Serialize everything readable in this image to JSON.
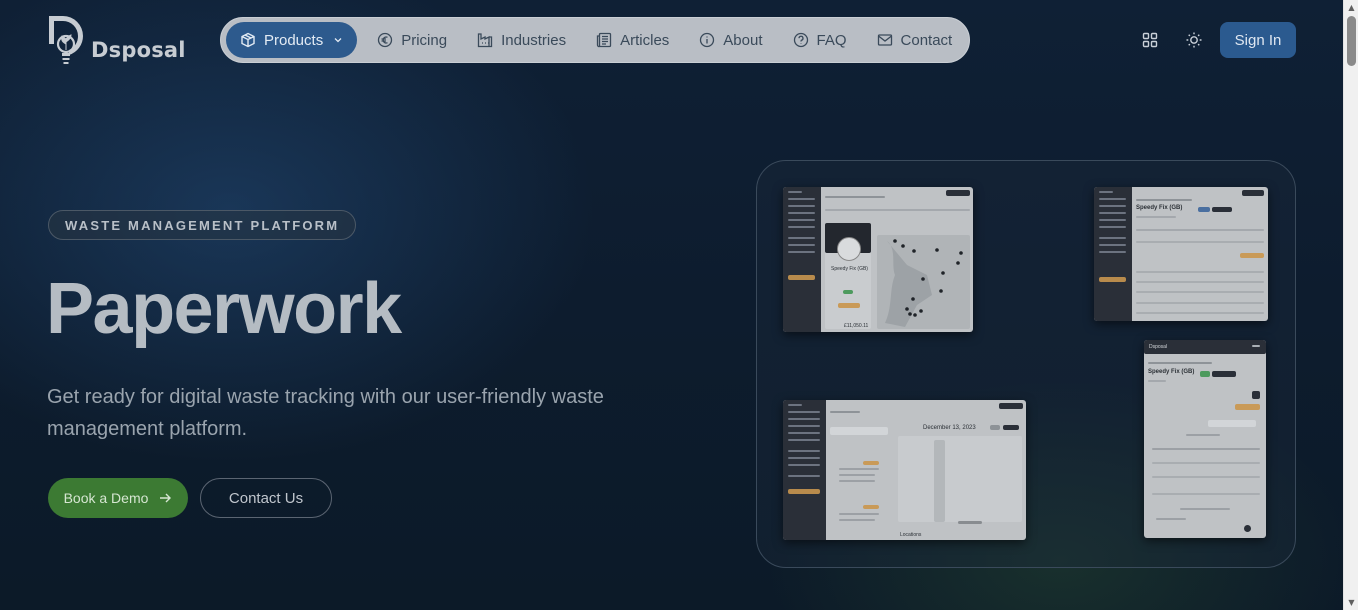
{
  "brand": {
    "name": "Dsposal"
  },
  "nav": {
    "items": [
      {
        "label": "Products",
        "icon": "box-icon",
        "active": true,
        "has_dropdown": true
      },
      {
        "label": "Pricing",
        "icon": "euro-icon"
      },
      {
        "label": "Industries",
        "icon": "factory-icon"
      },
      {
        "label": "Articles",
        "icon": "newspaper-icon"
      },
      {
        "label": "About",
        "icon": "info-icon"
      },
      {
        "label": "FAQ",
        "icon": "help-circle-icon"
      },
      {
        "label": "Contact",
        "icon": "mail-icon"
      }
    ]
  },
  "header": {
    "apps_icon": "grid-icon",
    "theme_icon": "sun-icon",
    "signin_label": "Sign In"
  },
  "hero": {
    "tag": "WASTE MANAGEMENT PLATFORM",
    "headline": "Paperwork",
    "subtitle": "Get ready for digital waste tracking with our user-friendly waste management platform.",
    "primary_cta": "Book a Demo",
    "secondary_cta": "Contact Us"
  },
  "screenshots": {
    "map": {
      "company": "Speedy Fix (GB)",
      "amount": "£11,050.11"
    },
    "detail": {
      "company": "Speedy Fix (GB)"
    },
    "calendar": {
      "date": "December 13, 2023",
      "section": "Locations"
    },
    "mobile": {
      "brand": "Dsposal",
      "company": "Speedy Fix (GB)"
    }
  },
  "colors": {
    "background": "#0d1c2e",
    "nav_active": "#2d5a8d",
    "signin": "#2b5a8f",
    "demo_button": "#3c7a33"
  }
}
